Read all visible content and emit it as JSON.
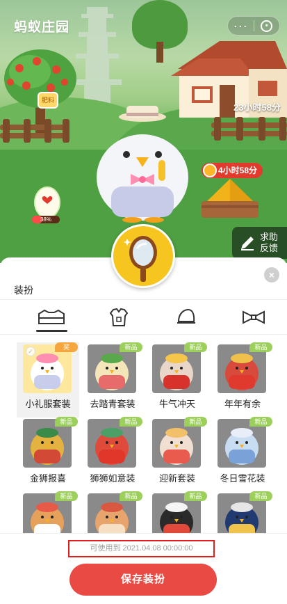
{
  "app": {
    "title": "蚂蚁庄园",
    "more_icon": "···"
  },
  "scene": {
    "tree_badge": "肥料",
    "house_timer": "23小时58分",
    "feed_timer": "4小时58分",
    "egg_progress": "38%",
    "egg_progress_value": 0.38,
    "help_button": "求助反馈"
  },
  "panel": {
    "title": "装扮",
    "close_icon": "×",
    "tabs": [
      {
        "icon": "outfit-set-icon",
        "active": true
      },
      {
        "icon": "clothes-icon",
        "active": false
      },
      {
        "icon": "hat-icon",
        "active": false
      },
      {
        "icon": "bowtie-icon",
        "active": false
      }
    ],
    "items": [
      {
        "name": "小礼服套装",
        "tag": "奖",
        "selected": true
      },
      {
        "name": "去踏青套装",
        "tag": "新品",
        "selected": false
      },
      {
        "name": "牛气冲天",
        "tag": "新品",
        "selected": false
      },
      {
        "name": "年年有余",
        "tag": "新品",
        "selected": false
      },
      {
        "name": "金狮报喜",
        "tag": "新品",
        "selected": false
      },
      {
        "name": "狮狮如意装",
        "tag": "新品",
        "selected": false
      },
      {
        "name": "迎新套装",
        "tag": "新品",
        "selected": false
      },
      {
        "name": "冬日雪花装",
        "tag": "新品",
        "selected": false
      },
      {
        "name": "",
        "tag": "新品",
        "selected": false
      },
      {
        "name": "",
        "tag": "新品",
        "selected": false
      },
      {
        "name": "",
        "tag": "新品",
        "selected": false
      },
      {
        "name": "",
        "tag": "新品",
        "selected": false
      }
    ],
    "expiry": "可使用到 2021.04.08 00:00:00",
    "save_button": "保存装扮"
  },
  "colors": {
    "accent": "#e94a43",
    "tag_new": "#9ccf5c",
    "tag_award": "#f6a63c",
    "highlight_border": "#e11d1d"
  }
}
